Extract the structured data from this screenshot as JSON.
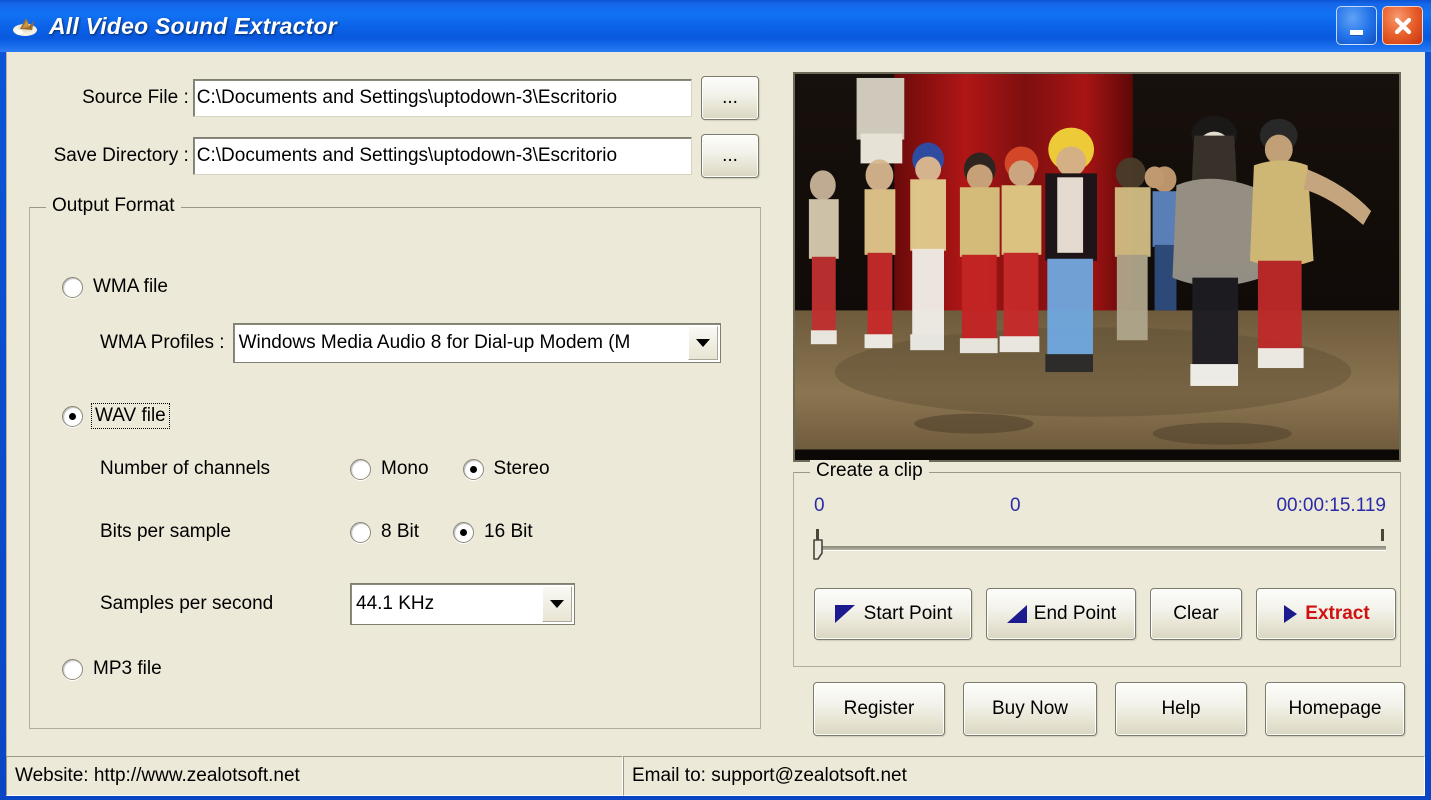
{
  "window": {
    "title": "All Video Sound Extractor",
    "icon": "app-sound-icon",
    "minimize_label": "Minimize",
    "close_label": "Close",
    "accent_titlebar": "#0B62E8",
    "body_color": "#ECE9D8"
  },
  "files": {
    "source_label": "Source File :",
    "source_value": "C:\\Documents and Settings\\uptodown-3\\Escritorio",
    "source_browse_label": "...",
    "save_label": "Save Directory :",
    "save_value": "C:\\Documents and Settings\\uptodown-3\\Escritorio",
    "save_browse_label": "..."
  },
  "output_format": {
    "group_title": "Output Format",
    "wma": {
      "label": "WMA file",
      "selected": false,
      "profiles_label": "WMA Profiles :",
      "profiles_value": "Windows Media Audio 8 for Dial-up Modem (M",
      "profiles_options": [
        "Windows Media Audio 8 for Dial-up Modem (M"
      ]
    },
    "wav": {
      "label": "WAV file",
      "selected": true,
      "focused": true,
      "channels_label": "Number of channels",
      "channels": [
        {
          "label": "Mono",
          "selected": false
        },
        {
          "label": "Stereo",
          "selected": true
        }
      ],
      "bits_label": "Bits per sample",
      "bits": [
        {
          "label": "8 Bit",
          "selected": false
        },
        {
          "label": "16 Bit",
          "selected": true
        }
      ],
      "samples_label": "Samples per second",
      "samples_value": "44.1 KHz",
      "samples_options": [
        "44.1 KHz"
      ]
    },
    "mp3": {
      "label": "MP3 file",
      "selected": false
    }
  },
  "clip": {
    "group_title": "Create a clip",
    "start_value": "0",
    "current_value": "0",
    "duration_value": "00:00:15.119",
    "time_color": "#2B2BA8",
    "slider_position_percent": 0,
    "buttons": {
      "start_point": "Start Point",
      "end_point": "End Point",
      "clear": "Clear",
      "extract": "Extract",
      "extract_color": "#D01111"
    }
  },
  "actions": {
    "register": "Register",
    "buy_now": "Buy Now",
    "help": "Help",
    "homepage": "Homepage"
  },
  "statusbar": {
    "website": "Website: http://www.zealotsoft.net",
    "email": "Email to: support@zealotsoft.net"
  }
}
